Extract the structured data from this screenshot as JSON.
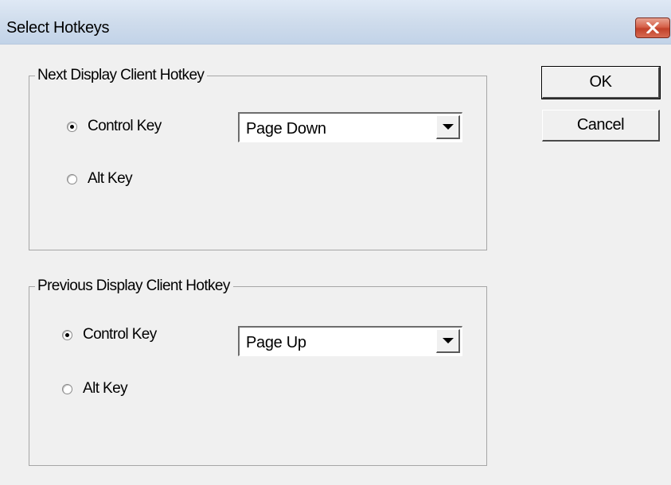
{
  "window": {
    "title": "Select Hotkeys",
    "close_icon": "close-icon"
  },
  "next_group": {
    "label": "Next Display Client Hotkey",
    "radio_control": {
      "label": "Control Key",
      "checked": true
    },
    "radio_alt": {
      "label": "Alt Key",
      "checked": false
    },
    "key_select": {
      "value": "Page Down"
    }
  },
  "previous_group": {
    "label": "Previous Display Client Hotkey",
    "radio_control": {
      "label": "Control Key",
      "checked": true
    },
    "radio_alt": {
      "label": "Alt Key",
      "checked": false
    },
    "key_select": {
      "value": "Page Up"
    }
  },
  "buttons": {
    "ok": "OK",
    "cancel": "Cancel"
  },
  "colors": {
    "dialog_bg": "#f0f0f0",
    "close_button": "#c2412a",
    "titlebar": "#cfdcec"
  }
}
